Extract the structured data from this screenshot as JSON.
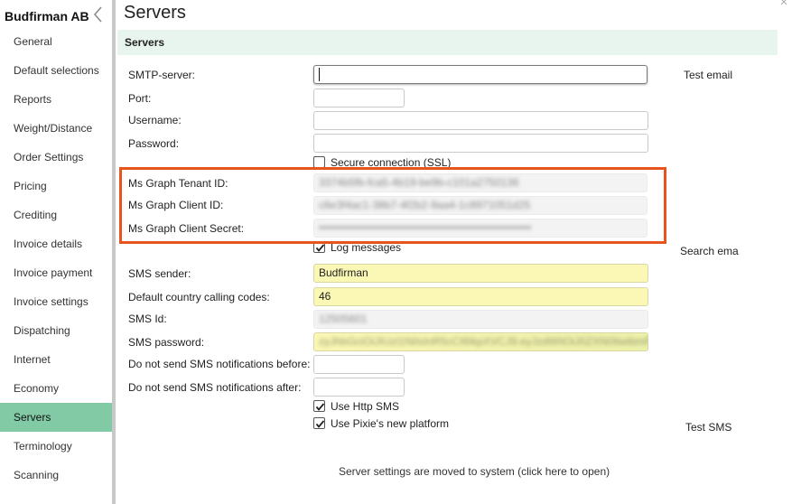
{
  "company": "Budfirman AB",
  "sidebar": {
    "items": [
      {
        "label": "General"
      },
      {
        "label": "Default selections"
      },
      {
        "label": "Reports"
      },
      {
        "label": "Weight/Distance"
      },
      {
        "label": "Order Settings"
      },
      {
        "label": "Pricing"
      },
      {
        "label": "Crediting"
      },
      {
        "label": "Invoice details"
      },
      {
        "label": "Invoice payment"
      },
      {
        "label": "Invoice settings"
      },
      {
        "label": "Dispatching"
      },
      {
        "label": "Internet"
      },
      {
        "label": "Economy"
      },
      {
        "label": "Servers"
      },
      {
        "label": "Terminology"
      },
      {
        "label": "Scanning"
      }
    ],
    "active": "Servers"
  },
  "page_title": "Servers",
  "section_title": "Servers",
  "fields": {
    "smtp_server": {
      "label": "SMTP-server:",
      "value": ""
    },
    "port": {
      "label": "Port:",
      "value": ""
    },
    "username": {
      "label": "Username:",
      "value": ""
    },
    "password": {
      "label": "Password:",
      "value": ""
    },
    "secure_connection": {
      "label": "Secure connection (SSL)",
      "checked": false
    },
    "ms_graph_tenant_id": {
      "label": "Ms Graph Tenant ID:",
      "value": "3374b5fb-fca5-4b19-be9b-c101a2750136"
    },
    "ms_graph_client_id": {
      "label": "Ms Graph Client ID:",
      "value": "c6e3f4ac1-38b7-4f2b2-9aa4-1c8971051d25"
    },
    "ms_graph_client_secret": {
      "label": "Ms Graph Client Secret:",
      "value": "••••••••••••••••••••••••••••••••••••••••••••••••••••••••"
    },
    "log_messages": {
      "label": "Log messages",
      "checked": true
    },
    "sms_sender": {
      "label": "SMS sender:",
      "value": "Budfirman"
    },
    "default_country_codes": {
      "label": "Default country calling codes:",
      "value": "46"
    },
    "sms_id": {
      "label": "SMS Id:",
      "value": "12505601"
    },
    "sms_password": {
      "label": "SMS password:",
      "value": "zyJhbGciOiJIUzI1NiIsInR5cCI6IkpXVCJ9.eyJzdWIiOiJ0ZXN0IiwibmFtZSI6"
    },
    "sms_before": {
      "label": "Do not send SMS notifications before:",
      "value": ""
    },
    "sms_after": {
      "label": "Do not send SMS notifications after:",
      "value": ""
    },
    "use_http_sms": {
      "label": "Use Http SMS",
      "checked": true
    },
    "use_pixie_platform": {
      "label": "Use Pixie's new platform",
      "checked": true
    }
  },
  "actions": {
    "test_email": "Test email",
    "search_email": "Search ema",
    "test_sms": "Test SMS"
  },
  "footer_link": "Server settings are moved to system (click here to open)",
  "colors": {
    "active_nav": "#82c9a5",
    "section_bg": "#e8f4ee",
    "highlight": "#e8541d",
    "yellow_field": "#fbf7b5"
  }
}
